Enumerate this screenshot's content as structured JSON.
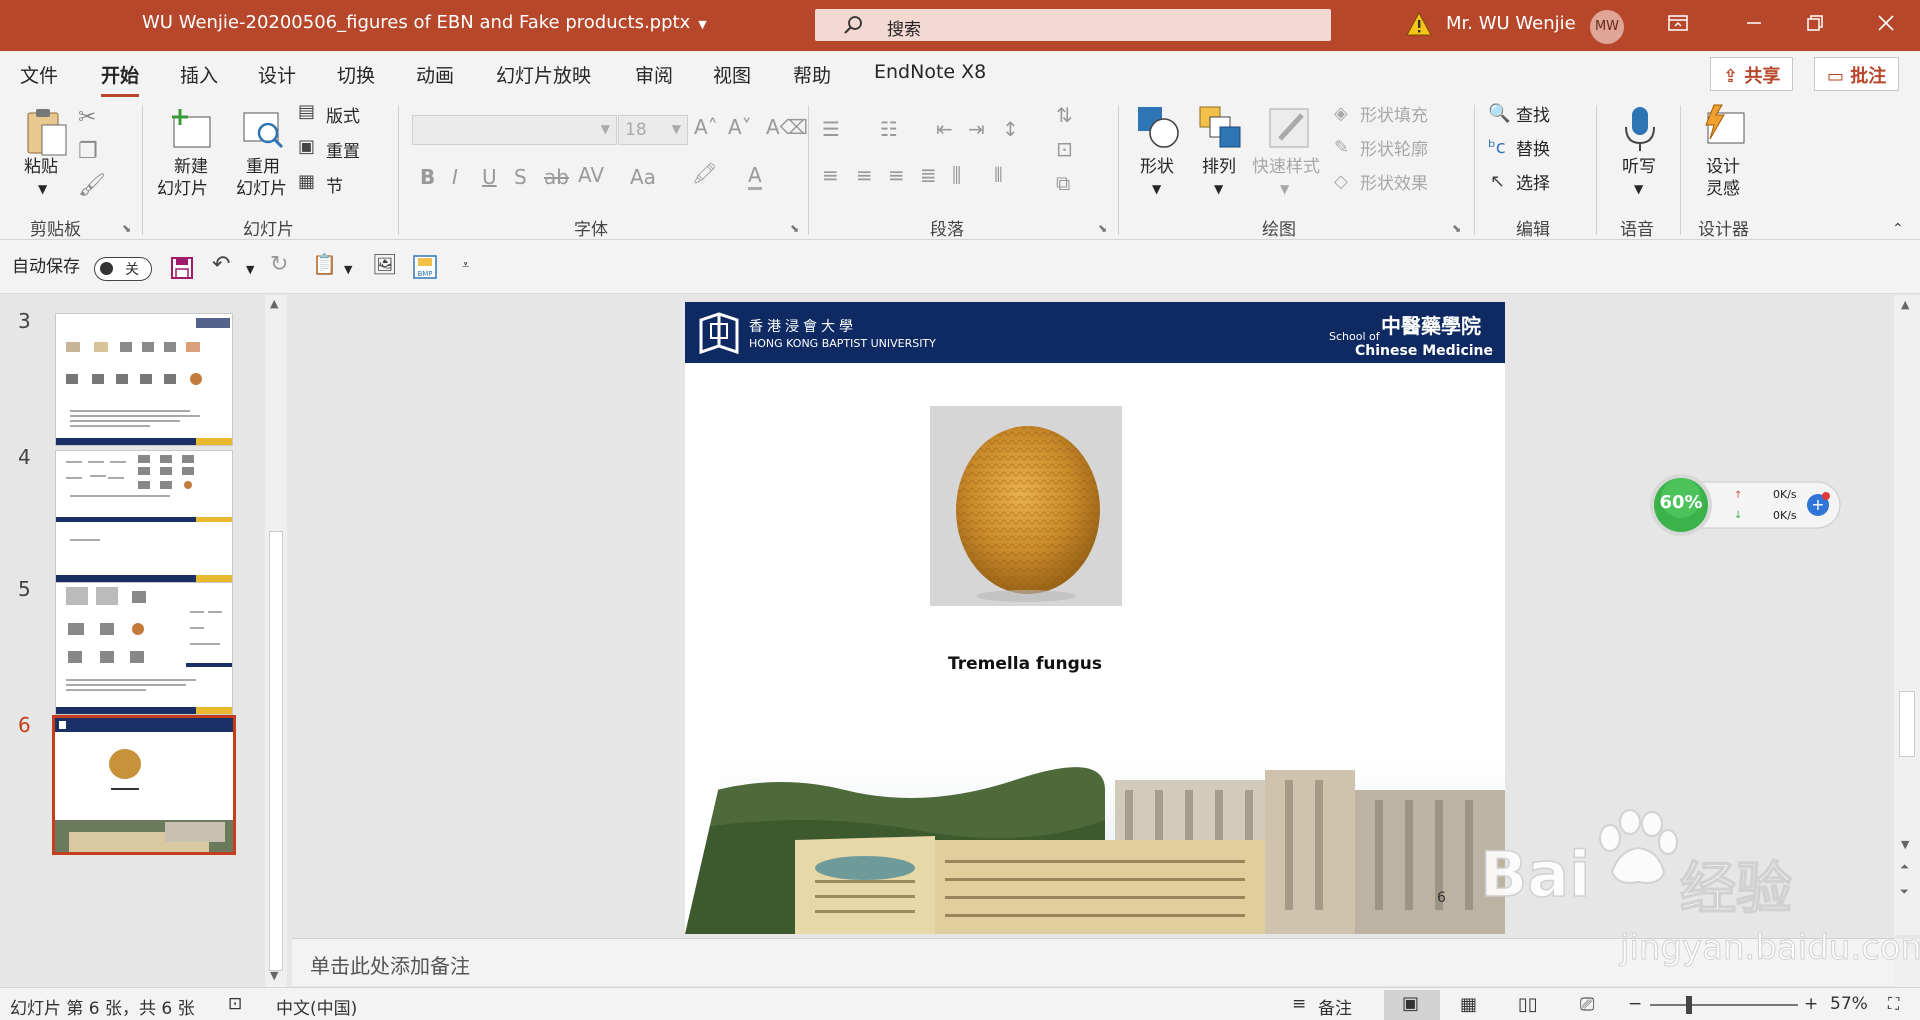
{
  "window": {
    "title": "WU Wenjie-20200506_figures of EBN and Fake products.pptx",
    "search_placeholder": "搜索",
    "user_name": "Mr. WU Wenjie",
    "user_initials": "MW"
  },
  "menu": {
    "tabs": [
      "文件",
      "开始",
      "插入",
      "设计",
      "切换",
      "动画",
      "幻灯片放映",
      "审阅",
      "视图",
      "帮助",
      "EndNote X8"
    ],
    "share_label": "共享",
    "comment_label": "批注"
  },
  "ribbon": {
    "clipboard": {
      "paste": "粘贴",
      "group": "剪贴板"
    },
    "slides": {
      "new_slide_1": "新建",
      "new_slide_2": "幻灯片",
      "reuse_1": "重用",
      "reuse_2": "幻灯片",
      "layout": "版式",
      "reset": "重置",
      "section": "节",
      "group": "幻灯片"
    },
    "font": {
      "size": "18",
      "group": "字体"
    },
    "paragraph": {
      "group": "段落"
    },
    "drawing": {
      "shapes": "形状",
      "arrange": "排列",
      "quick_styles": "快速样式",
      "fill": "形状填充",
      "outline": "形状轮廓",
      "effects": "形状效果",
      "group": "绘图"
    },
    "editing": {
      "find": "查找",
      "replace": "替换",
      "select": "选择",
      "group": "编辑"
    },
    "voice": {
      "dictate": "听写",
      "group": "语音"
    },
    "designer": {
      "design_1": "设计",
      "design_2": "灵感",
      "group": "设计器"
    }
  },
  "qat": {
    "autosave_label": "自动保存",
    "autosave_state": "关"
  },
  "thumbnails": [
    {
      "number": "3",
      "selected": false
    },
    {
      "number": "4",
      "selected": false
    },
    {
      "number": "5",
      "selected": false
    },
    {
      "number": "6",
      "selected": true
    }
  ],
  "slide": {
    "uni_name_cn": "香港浸會大學",
    "uni_name_en": "HONG KONG BAPTIST UNIVERSITY",
    "school_of": "School of",
    "school_cn": "中醫藥學院",
    "school_en": "Chinese Medicine",
    "caption": "Tremella fungus",
    "page_number": "6"
  },
  "notes_placeholder": "单击此处添加备注",
  "status": {
    "slide_info": "幻灯片 第 6 张，共 6 张",
    "language": "中文(中国)",
    "notes_label": "备注",
    "zoom": "57%"
  },
  "net_widget": {
    "percent": "60%",
    "up": "0K/s",
    "down": "0K/s"
  },
  "watermark": {
    "brand": "Bai",
    "brand_cn": "经验",
    "url": "jingyan.baidu.com"
  },
  "colors": {
    "accent": "#b7472a",
    "slide_header": "#0f2a63",
    "selected_thumb": "#c43e1c",
    "gold": "#e8b82e"
  }
}
